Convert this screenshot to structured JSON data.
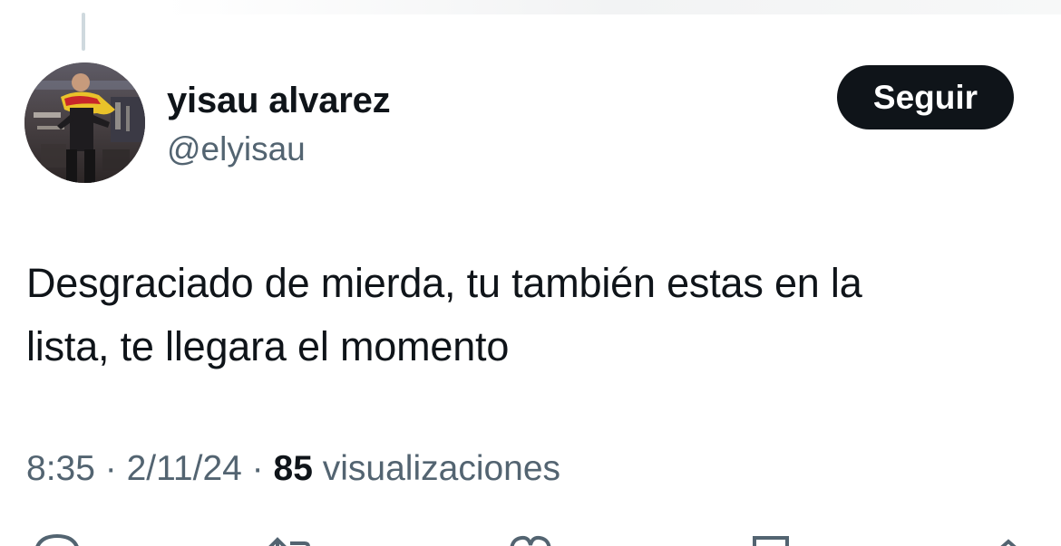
{
  "tweet": {
    "author": {
      "display_name": "yisau alvarez",
      "handle": "@elyisau",
      "avatar_icon": "profile-photo"
    },
    "follow_button_label": "Seguir",
    "text_lines": [
      "Desgraciado de mierda, tu también estas en la",
      "lista, te llegara el momento"
    ],
    "meta": {
      "time": "8:35",
      "separator": "·",
      "date": "2/11/24",
      "views_count": "85",
      "views_label": "visualizaciones"
    },
    "actions": [
      {
        "name": "reply",
        "icon": "reply-icon"
      },
      {
        "name": "retweet",
        "icon": "retweet-icon"
      },
      {
        "name": "like",
        "icon": "heart-icon"
      },
      {
        "name": "bookmark",
        "icon": "bookmark-icon"
      },
      {
        "name": "share",
        "icon": "share-icon"
      }
    ]
  },
  "colors": {
    "text_primary": "#0f1419",
    "text_secondary": "#536471",
    "button_bg": "#0f1419",
    "thread_line": "#cfd9de"
  }
}
